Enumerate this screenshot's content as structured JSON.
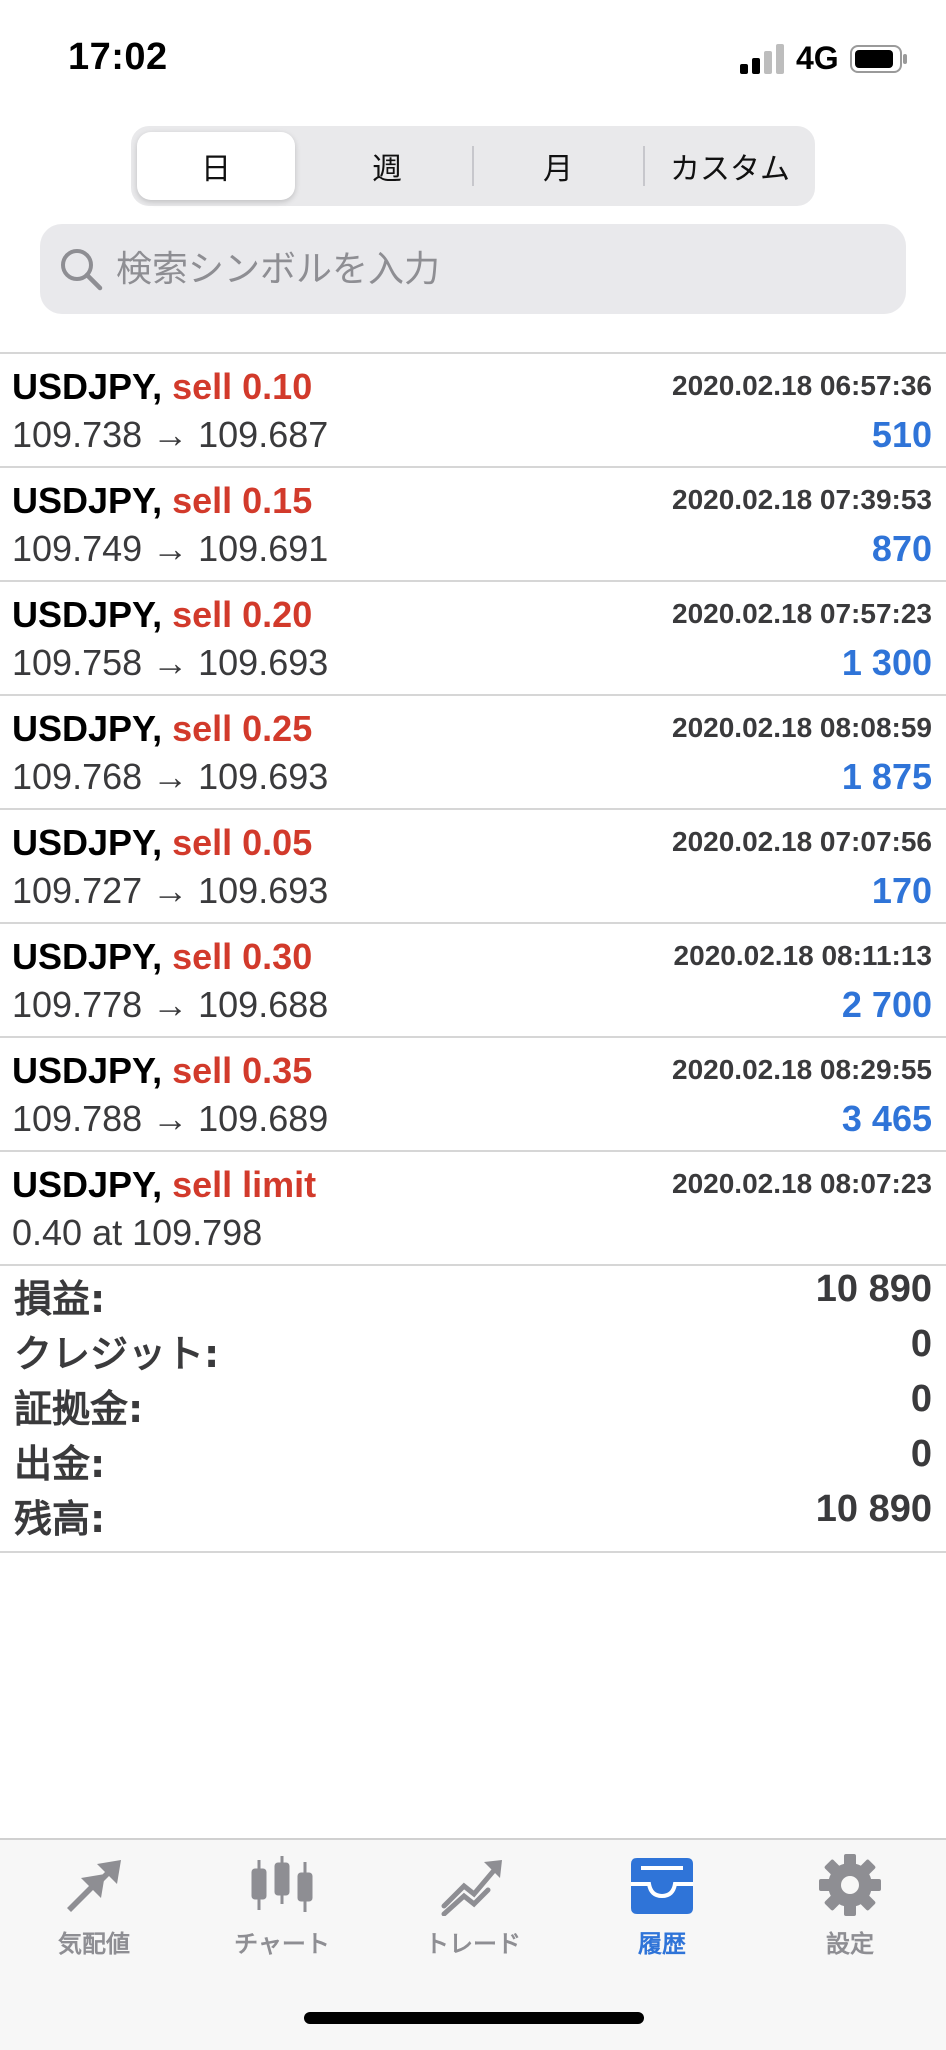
{
  "status_bar": {
    "time": "17:02",
    "network": "4G"
  },
  "period_tabs": [
    {
      "label": "日",
      "active": true
    },
    {
      "label": "週",
      "active": false
    },
    {
      "label": "月",
      "active": false
    },
    {
      "label": "カスタム",
      "active": false
    }
  ],
  "search": {
    "placeholder": "検索シンボルを入力"
  },
  "trades": [
    {
      "symbol": "USDJPY,",
      "side": "sell 0.10",
      "time": "2020.02.18 06:57:36",
      "prices": "109.738 → 109.687",
      "profit": "510"
    },
    {
      "symbol": "USDJPY,",
      "side": "sell 0.15",
      "time": "2020.02.18 07:39:53",
      "prices": "109.749 → 109.691",
      "profit": "870"
    },
    {
      "symbol": "USDJPY,",
      "side": "sell 0.20",
      "time": "2020.02.18 07:57:23",
      "prices": "109.758 → 109.693",
      "profit": "1 300"
    },
    {
      "symbol": "USDJPY,",
      "side": "sell 0.25",
      "time": "2020.02.18 08:08:59",
      "prices": "109.768 → 109.693",
      "profit": "1 875"
    },
    {
      "symbol": "USDJPY,",
      "side": "sell 0.05",
      "time": "2020.02.18 07:07:56",
      "prices": "109.727 → 109.693",
      "profit": "170"
    },
    {
      "symbol": "USDJPY,",
      "side": "sell 0.30",
      "time": "2020.02.18 08:11:13",
      "prices": "109.778 → 109.688",
      "profit": "2 700"
    },
    {
      "symbol": "USDJPY,",
      "side": "sell 0.35",
      "time": "2020.02.18 08:29:55",
      "prices": "109.788 → 109.689",
      "profit": "3 465"
    },
    {
      "symbol": "USDJPY,",
      "side": "sell limit",
      "time": "2020.02.18 08:07:23",
      "prices": "0.40 at 109.798",
      "profit": ""
    }
  ],
  "summary": [
    {
      "label": "損益:",
      "value": "10 890"
    },
    {
      "label": "クレジット:",
      "value": "0"
    },
    {
      "label": "証拠金:",
      "value": "0"
    },
    {
      "label": "出金:",
      "value": "0"
    },
    {
      "label": "残高:",
      "value": "10 890"
    }
  ],
  "tab_bar": [
    {
      "label": "気配値",
      "icon": "quotes-icon",
      "active": false
    },
    {
      "label": "チャート",
      "icon": "candlestick-chart-icon",
      "active": false
    },
    {
      "label": "トレード",
      "icon": "trade-icon",
      "active": false
    },
    {
      "label": "履歴",
      "icon": "history-tray-icon",
      "active": true
    },
    {
      "label": "設定",
      "icon": "gear-icon",
      "active": false
    }
  ],
  "colors": {
    "sell": "#d23a2b",
    "profit": "#2f74d8",
    "active_tab": "#2f74d8",
    "inactive_tab": "#8e8e93"
  }
}
